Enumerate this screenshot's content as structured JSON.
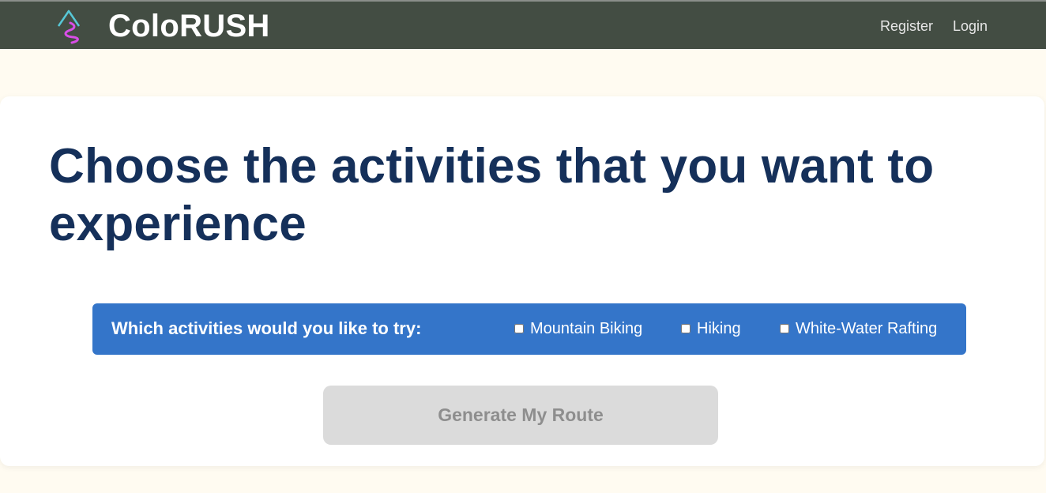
{
  "header": {
    "brand": "ColoRUSH",
    "logo_icon": "mountain-trail-icon",
    "nav": {
      "register": "Register",
      "login": "Login"
    },
    "colors": {
      "bar": "#434d43",
      "logo_mountain": "#57c7d6",
      "logo_trail": "#d94ee8"
    }
  },
  "main": {
    "headline": "Choose the activities that you want to experience",
    "activity_prompt": "Which activities would you like to try:",
    "activities": [
      {
        "label": "Mountain Biking",
        "checked": false
      },
      {
        "label": "Hiking",
        "checked": false
      },
      {
        "label": "White-Water Rafting",
        "checked": false
      }
    ],
    "generate_label": "Generate My Route",
    "generate_disabled": true,
    "colors": {
      "page_background": "#fffbf1",
      "headline": "#15305a",
      "activity_bar": "#3475c9",
      "button_disabled": "#dbdbdb"
    }
  }
}
